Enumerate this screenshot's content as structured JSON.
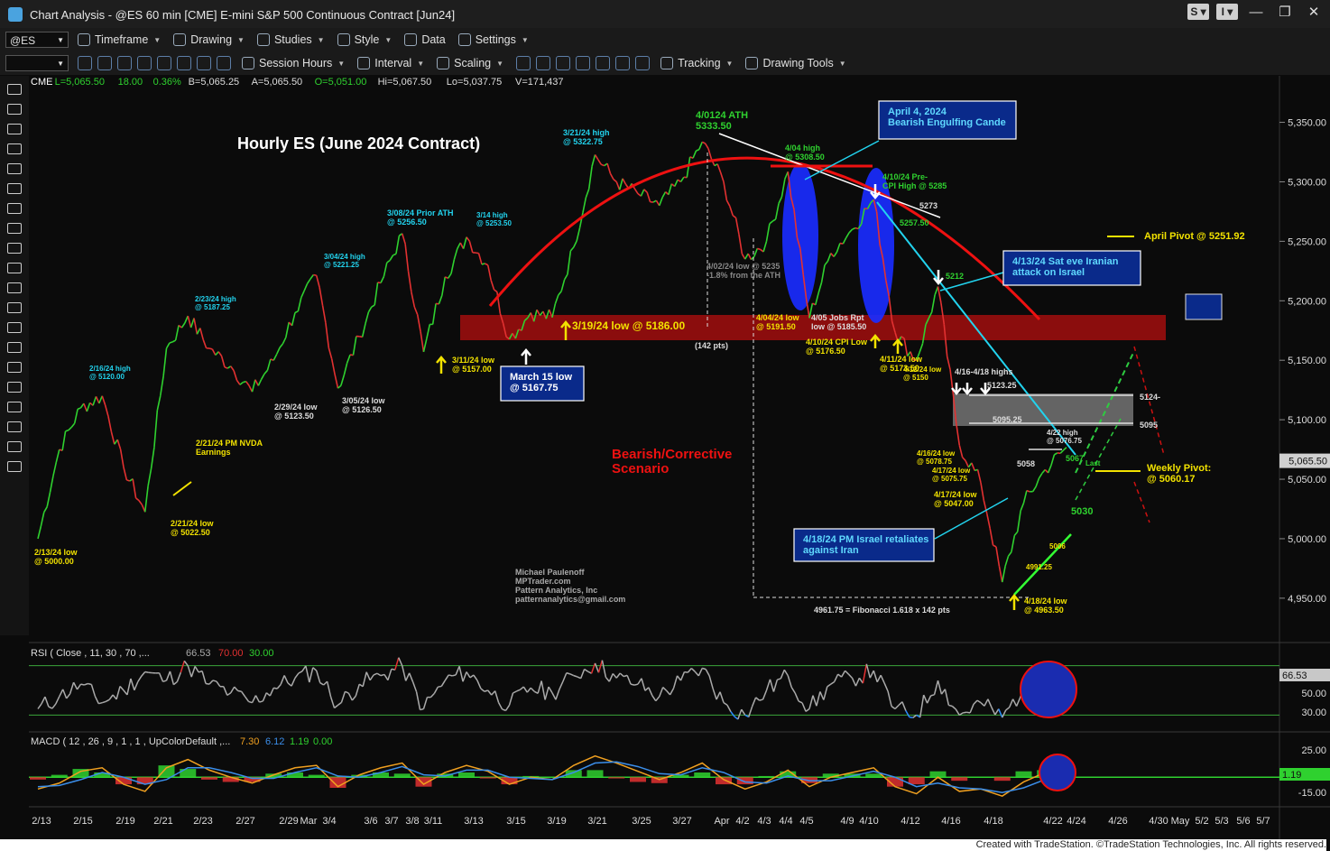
{
  "window": {
    "title": "Chart Analysis - @ES 60 min [CME] E-mini S&P 500 Continuous Contract [Jun24]"
  },
  "toolbar1": {
    "symbol": "@ES",
    "items": [
      "Timeframe",
      "Drawing",
      "Studies",
      "Style",
      "Data",
      "Settings"
    ]
  },
  "toolbar2": {
    "items": [
      "Session Hours",
      "Interval",
      "Scaling",
      "Tracking",
      "Drawing Tools"
    ]
  },
  "quote_line": {
    "exchange": "CME",
    "L": "L=5,065.50",
    "chg": "18.00",
    "pct": "0.36%",
    "B": "B=5,065.25",
    "A": "A=5,065.50",
    "O": "O=5,051.00",
    "Hi": "Hi=5,067.50",
    "Lo": "Lo=5,037.75",
    "V": "V=171,437"
  },
  "footer": "Created with TradeStation. ©TradeStation Technologies, Inc. All rights reserved.",
  "chart_data": [
    {
      "type": "line",
      "title": "Hourly ES (June 2024 Contract)",
      "ylim": [
        4915,
        5380
      ],
      "y_ticks": [
        4950,
        5000,
        5050,
        5100,
        5150,
        5200,
        5250,
        5300,
        5350
      ],
      "y_tick_labels": [
        "4,950.00",
        "5,000.00",
        "5,050.00",
        "5,100.00",
        "5,150.00",
        "5,200.00",
        "5,250.00",
        "5,300.00",
        "5,350.00"
      ],
      "last_price_label": "5,065.50",
      "x_tick_labels": [
        "2/13",
        "2/15",
        "2/19",
        "2/21",
        "2/23",
        "2/27",
        "2/29",
        "Mar",
        "3/4",
        "3/6",
        "3/7",
        "3/8",
        "3/11",
        "3/13",
        "3/15",
        "3/19",
        "3/21",
        "3/25",
        "3/27",
        "Apr",
        "4/2",
        "4/3",
        "4/4",
        "4/5",
        "4/9",
        "4/10",
        "4/12",
        "4/16",
        "4/18",
        "4/22",
        "4/24",
        "4/26",
        "4/30",
        "May",
        "5/2",
        "5/3",
        "5/6",
        "5/7"
      ],
      "x": [
        "2/13",
        "2/14",
        "2/15",
        "2/16",
        "2/20",
        "2/21",
        "2/22",
        "2/23",
        "2/26",
        "2/27",
        "2/28",
        "2/29",
        "3/1",
        "3/4",
        "3/5",
        "3/6",
        "3/7",
        "3/8",
        "3/11",
        "3/12",
        "3/13",
        "3/14",
        "3/15",
        "3/18",
        "3/19",
        "3/20",
        "3/21",
        "3/22",
        "3/25",
        "3/26",
        "3/27",
        "3/28",
        "4/1",
        "4/2",
        "4/3",
        "4/4",
        "4/5",
        "4/8",
        "4/9",
        "4/10",
        "4/11",
        "4/12",
        "4/15",
        "4/16",
        "4/17",
        "4/18",
        "4/19",
        "4/22",
        "4/23"
      ],
      "series": [
        {
          "values": [
            5000,
            5075,
            5110,
            5120,
            5060,
            5022.5,
            5160,
            5187.25,
            5160,
            5145,
            5123.5,
            5150,
            5190,
            5221.25,
            5126.5,
            5170,
            5215,
            5256.5,
            5157,
            5220,
            5253.5,
            5230,
            5167.75,
            5190,
            5186,
            5245,
            5322.75,
            5300,
            5290,
            5280,
            5300,
            5333.5,
            5300,
            5235,
            5250,
            5308.5,
            5185.5,
            5240,
            5260,
            5285,
            5173.5,
            5150,
            5212,
            5078.75,
            5047,
            4963.5,
            5030,
            5058,
            5076.75
          ]
        }
      ],
      "annotations": [
        {
          "text": "2/13/24 low\n@ 5000.00"
        },
        {
          "text": "2/16/24 high\n@ 5120.00"
        },
        {
          "text": "2/21/24 PM NVDA\nEarnings"
        },
        {
          "text": "2/21/24 low\n@ 5022.50"
        },
        {
          "text": "2/23/24 high\n@ 5187.25"
        },
        {
          "text": "2/29/24 low\n@ 5123.50"
        },
        {
          "text": "3/04/24 high\n@ 5221.25"
        },
        {
          "text": "3/05/24 low\n@ 5126.50"
        },
        {
          "text": "3/08/24 Prior ATH\n@ 5256.50"
        },
        {
          "text": "3/11/24 low\n@ 5157.00"
        },
        {
          "text": "3/14 high\n@ 5253.50"
        },
        {
          "text": "3/21/24 high\n@ 5322.75"
        },
        {
          "text": "4/0124 ATH\n5333.50"
        },
        {
          "text": "4/04 high\n@ 5308.50"
        },
        {
          "text": "4/02/24 low @ 5235\n-1.8% from the ATH"
        },
        {
          "text": "(142 pts)"
        },
        {
          "text": "4/04/24 low\n@ 5191.50"
        },
        {
          "text": "4/05 Jobs Rpt\nlow @ 5185.50"
        },
        {
          "text": "4/10/24 CPI Low\n@ 5176.50"
        },
        {
          "text": "4/10/24 Pre-\nCPI High @ 5285"
        },
        {
          "text": "5273"
        },
        {
          "text": "5257.50"
        },
        {
          "text": "4/11/24 low\n@ 5173.50"
        },
        {
          "text": "4/12/24 low\n@ 5150"
        },
        {
          "text": "5212"
        },
        {
          "text": "4/16-4/18 highs"
        },
        {
          "text": "5123.25"
        },
        {
          "text": "5095.25"
        },
        {
          "text": "5124-"
        },
        {
          "text": "5095"
        },
        {
          "text": "4/16/24 low\n@ 5078.75"
        },
        {
          "text": "4/17/24 low\n@ 5075.75"
        },
        {
          "text": "4/17/24 low\n@ 5047.00"
        },
        {
          "text": "5058"
        },
        {
          "text": "4/22 high\n@ 5076.75"
        },
        {
          "text": "5067"
        },
        {
          "text": "Last"
        },
        {
          "text": "5030"
        },
        {
          "text": "5006"
        },
        {
          "text": "4991.25"
        },
        {
          "text": "4/18/24 low\n@ 4963.50"
        },
        {
          "text": "4961.75 = Fibonacci 1.618 x 142 pts"
        },
        {
          "text": "3/19/24 low @ 5186.00"
        },
        {
          "text": "Bearish/Corrective\nScenario"
        },
        {
          "text": "Michael Paulenoff\nMPTrader.com\nPattern Analytics, Inc\npatternanalytics@gmail.com"
        }
      ],
      "callouts": [
        {
          "text": "April 4, 2024\nBearish Engulfing Cande"
        },
        {
          "text": "4/13/24 Sat eve Iranian\nattack on Israel"
        },
        {
          "text": "March 15 low\n@ 5167.75"
        },
        {
          "text": "4/18/24 PM Israel retaliates\nagainst Iran"
        }
      ],
      "pivots": [
        {
          "label": "April Pivot @ 5251.92",
          "value": 5251.92
        },
        {
          "label": "Weekly Pivot:\n@ 5060.17",
          "value": 5060.17
        }
      ],
      "colors": {
        "up": "#2fd12f",
        "down": "#e23131",
        "support_zone": "#8b0d0d",
        "arc": "#ee1111",
        "callout_bg": "#0a2a8a",
        "pivot": "#f2e200"
      }
    },
    {
      "type": "line",
      "title": "RSI ( Close , 11, 30 , 70 ,...",
      "legend_values": [
        "66.53",
        "70.00",
        "30.00"
      ],
      "ylim": [
        20,
        80
      ],
      "y_tick_labels": [
        "50.00",
        "30.00"
      ],
      "last_value": "66.53",
      "series": [
        {
          "values": [
            35,
            45,
            55,
            40,
            50,
            65,
            58,
            70,
            55,
            48,
            40,
            52,
            60,
            66,
            38,
            55,
            62,
            70,
            35,
            58,
            65,
            50,
            38,
            52,
            48,
            62,
            72,
            60,
            55,
            45,
            58,
            68,
            40,
            30,
            50,
            62,
            35,
            55,
            60,
            66,
            35,
            30,
            58,
            30,
            40,
            28,
            52,
            60,
            66.53
          ]
        }
      ]
    },
    {
      "type": "line",
      "title": "MACD ( 12 , 26 , 9 , 1 , 1 , UpColorDefault ,...",
      "legend_values": [
        "7.30",
        "6.12",
        "1.19",
        "0.00"
      ],
      "ylim": [
        -22,
        30
      ],
      "y_tick_labels": [
        "25.00",
        "-15.00"
      ],
      "last_value": "1.19",
      "series": [
        {
          "values": [
            -10,
            -5,
            5,
            8,
            -6,
            -12,
            8,
            15,
            6,
            0,
            -5,
            2,
            8,
            10,
            -8,
            2,
            8,
            12,
            -6,
            4,
            10,
            5,
            -6,
            0,
            -2,
            10,
            18,
            12,
            5,
            -2,
            4,
            12,
            -2,
            -10,
            -4,
            6,
            -8,
            0,
            4,
            8,
            -8,
            -14,
            0,
            -12,
            -10,
            -16,
            -4,
            4,
            7.3
          ]
        },
        {
          "values": [
            -8,
            -7,
            -2,
            4,
            0,
            -6,
            -2,
            8,
            8,
            4,
            -1,
            -1,
            4,
            8,
            1,
            0,
            4,
            9,
            2,
            1,
            6,
            6,
            0,
            -1,
            -2,
            4,
            12,
            13,
            9,
            3,
            2,
            8,
            4,
            -4,
            -5,
            1,
            -3,
            -3,
            1,
            5,
            0,
            -8,
            -5,
            -9,
            -10,
            -13,
            -9,
            -2,
            6.12
          ]
        }
      ]
    }
  ]
}
